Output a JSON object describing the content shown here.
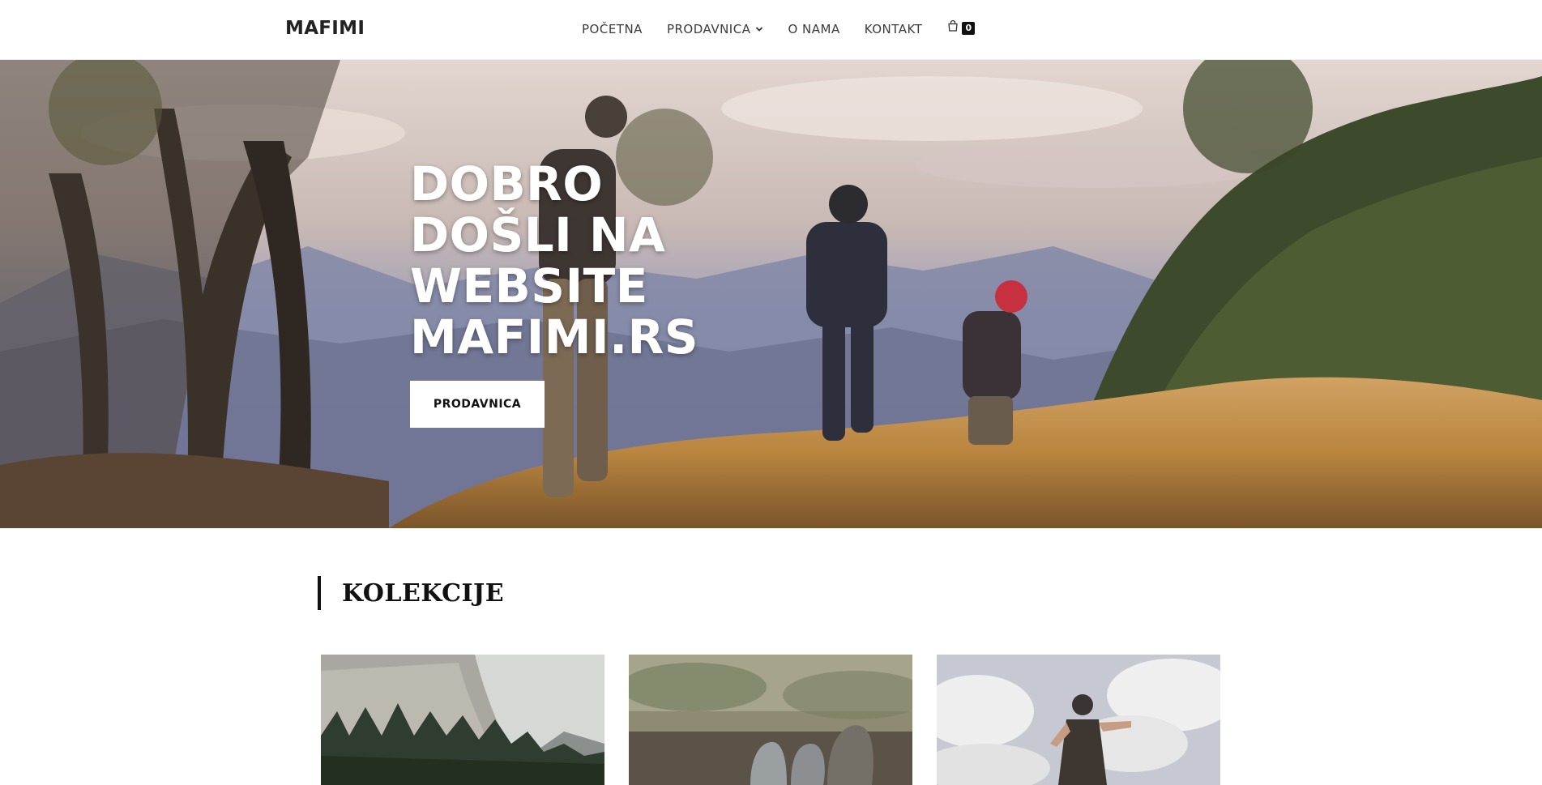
{
  "header": {
    "logo": "MAFIMI",
    "nav": [
      {
        "label": "POČETNA"
      },
      {
        "label": "PRODAVNICA",
        "has_dropdown": true
      },
      {
        "label": "O NAMA"
      },
      {
        "label": "KONTAKT"
      }
    ],
    "cart": {
      "icon": "shopping-bag-icon",
      "count": "0"
    }
  },
  "hero": {
    "title": "DOBRO DOŠLI NA WEBSITE MAFIMI.RS",
    "button_label": "PRODAVNICA"
  },
  "collections": {
    "title": "KOLEKCIJE",
    "cards": [
      {
        "name": "collection-card-mountain-forest"
      },
      {
        "name": "collection-card-socks"
      },
      {
        "name": "collection-card-hiker-clouds"
      }
    ]
  },
  "colors": {
    "header_bg": "#ffffff",
    "text_dark": "#222222",
    "accent": "#111111"
  }
}
